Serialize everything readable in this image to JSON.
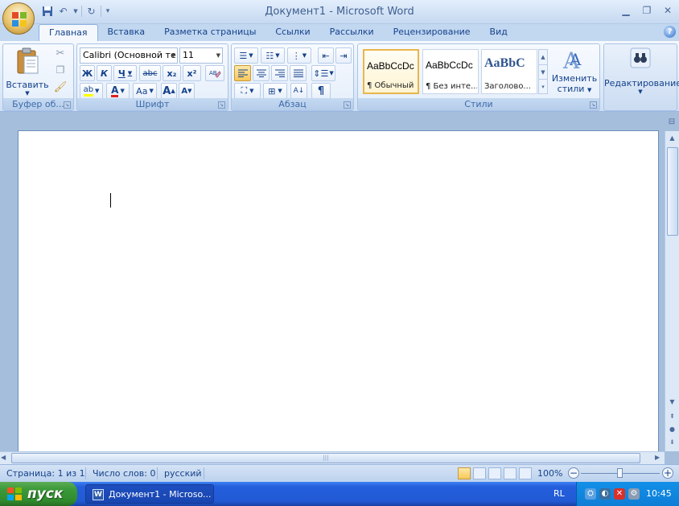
{
  "window": {
    "title": "Документ1 - Microsoft Word"
  },
  "ribbon": {
    "tabs": [
      "Главная",
      "Вставка",
      "Разметка страницы",
      "Ссылки",
      "Рассылки",
      "Рецензирование",
      "Вид"
    ],
    "clipboard": {
      "paste_label": "Вставить",
      "group_label": "Буфер об..."
    },
    "font": {
      "font_name": "Calibri (Основной те",
      "font_size": "11",
      "bold": "Ж",
      "italic": "К",
      "underline": "Ч",
      "strike": "abc",
      "subscript": "x₂",
      "superscript": "x²",
      "case": "Aa",
      "grow": "A",
      "shrink": "A",
      "color_letter": "A",
      "highlight": "ab",
      "group_label": "Шрифт"
    },
    "paragraph": {
      "pilcrow": "¶",
      "group_label": "Абзац"
    },
    "styles": {
      "cards": [
        {
          "sample": "AaBbCcDc",
          "name": "¶ Обычный"
        },
        {
          "sample": "AaBbCcDc",
          "name": "¶ Без инте..."
        },
        {
          "sample": "AaBbC",
          "name": "Заголово..."
        }
      ],
      "change_styles_line1": "Изменить",
      "change_styles_line2": "стили",
      "group_label": "Стили"
    },
    "editing": {
      "label": "Редактирование"
    }
  },
  "statusbar": {
    "page": "Страница: 1 из 1",
    "words": "Число слов: 0",
    "language": "русский",
    "zoom": "100%"
  },
  "taskbar": {
    "start_label": "пуск",
    "task_label": "Документ1 - Microso...",
    "lang": "RL",
    "clock": "10:45"
  },
  "colors": {
    "word_blue": "#15428b",
    "taskbar_blue": "#245edb",
    "start_green": "#3c9a3a",
    "highlight_active": "#f8c85a"
  }
}
